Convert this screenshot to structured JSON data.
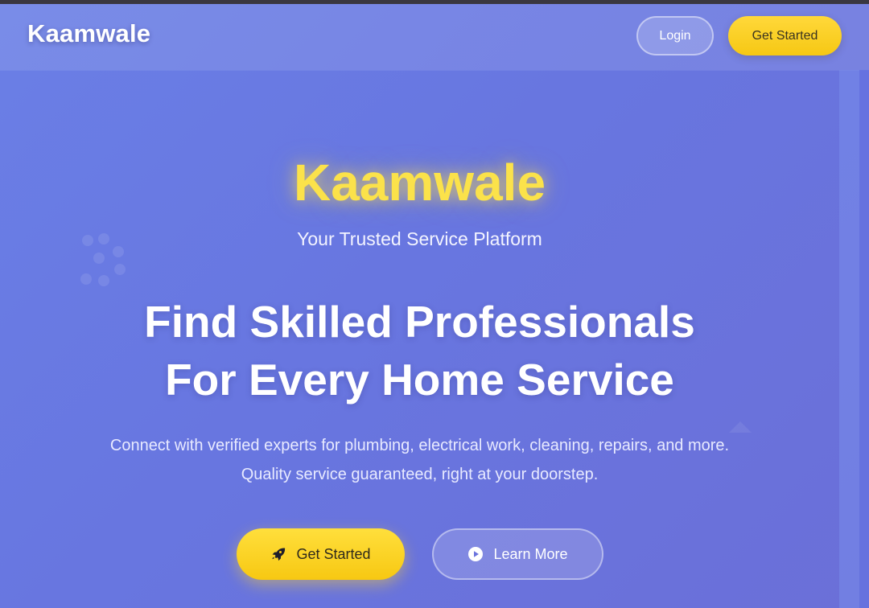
{
  "navbar": {
    "brand": "Kaamwale",
    "login_label": "Login",
    "get_started_label": "Get Started"
  },
  "hero": {
    "title": "Kaamwale",
    "subtitle": "Your Trusted Service Platform",
    "headline_line1": "Find Skilled Professionals",
    "headline_line2": "For Every Home Service",
    "description_line1": "Connect with verified experts for plumbing, electrical work, cleaning, repairs, and more.",
    "description_line2": "Quality service guaranteed, right at your doorstep.",
    "primary_cta": {
      "label": "Get Started",
      "icon": "rocket-icon"
    },
    "secondary_cta": {
      "label": "Learn More",
      "icon": "play-circle-icon"
    }
  },
  "colors": {
    "background": "#6876e0",
    "accent_yellow": "#fbd92c",
    "title_yellow": "#fbe24a",
    "text_white": "#ffffff"
  }
}
